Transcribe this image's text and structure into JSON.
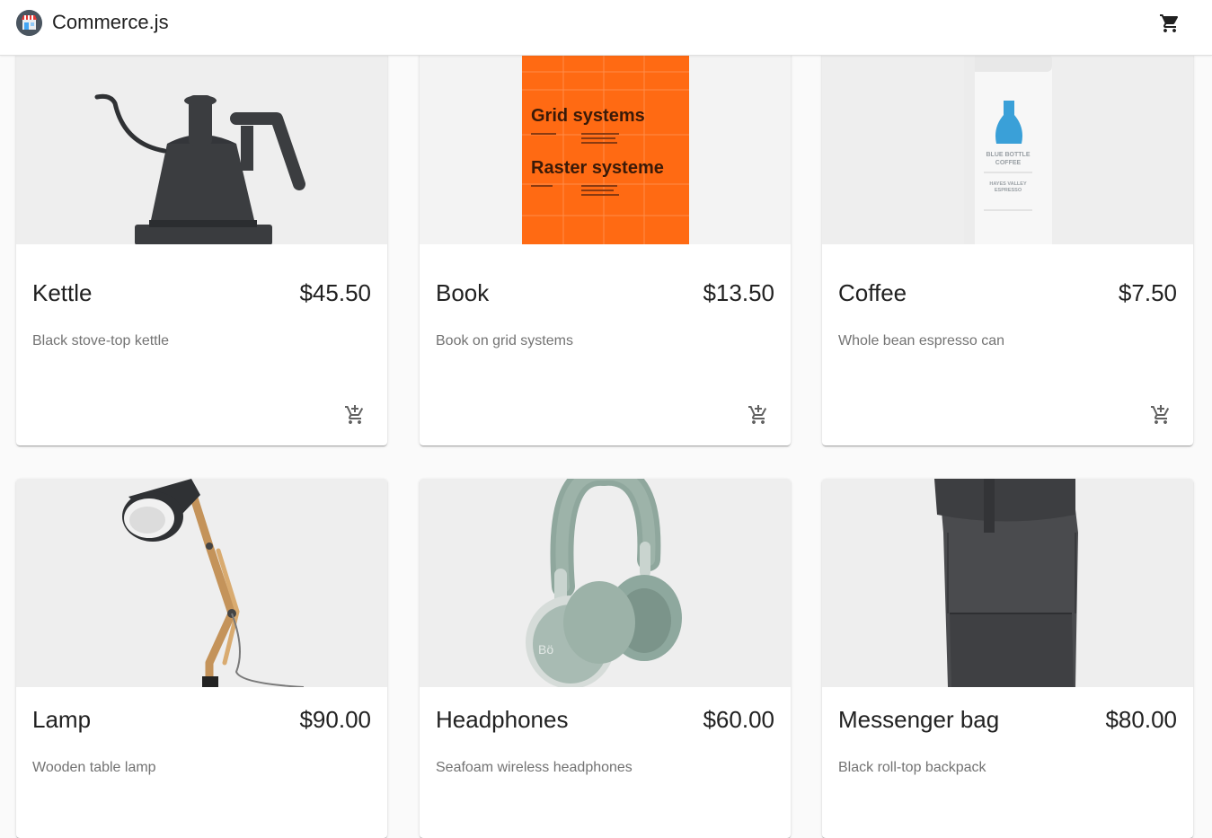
{
  "appbar": {
    "brand": "Commerce.js",
    "logo_icon": "storefront-logo-icon",
    "cart_icon": "shopping-cart-icon"
  },
  "colors": {
    "appbar_bg": "#ffffff",
    "page_bg": "#fafafa",
    "media_bg": "#eeeeee",
    "book_orange": "#ff6a13",
    "text_primary": "#212121",
    "text_secondary": "#737373"
  },
  "products": [
    {
      "name": "Kettle",
      "price": "$45.50",
      "description": "Black stove-top kettle"
    },
    {
      "name": "Book",
      "price": "$13.50",
      "description": "Book on grid systems"
    },
    {
      "name": "Coffee",
      "price": "$7.50",
      "description": "Whole bean espresso can"
    },
    {
      "name": "Lamp",
      "price": "$90.00",
      "description": "Wooden table lamp"
    },
    {
      "name": "Headphones",
      "price": "$60.00",
      "description": "Seafoam wireless headphones"
    },
    {
      "name": "Messenger bag",
      "price": "$80.00",
      "description": "Black roll-top backpack"
    }
  ],
  "product_images": {
    "book": {
      "title_1": "Grid systems",
      "title_2": "Raster systeme"
    },
    "coffee": {
      "brand_line_1": "BLUE BOTTLE",
      "brand_line_2": "COFFEE",
      "blend_line_1": "HAYES VALLEY",
      "blend_line_2": "ESPRESSO"
    }
  },
  "add_to_cart_icon": "add-shopping-cart-icon"
}
